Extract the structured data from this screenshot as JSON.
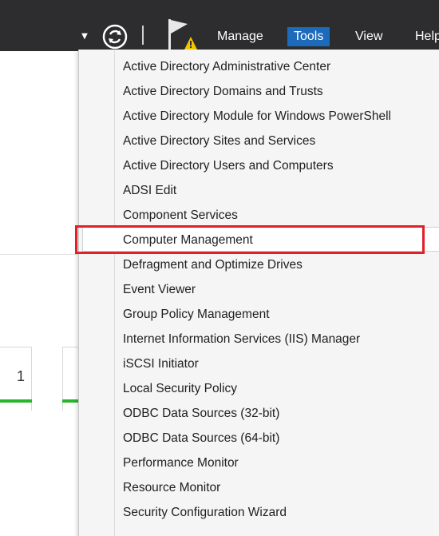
{
  "toolbar": {
    "menus": [
      "Manage",
      "Tools",
      "View",
      "Help"
    ],
    "active_menu": "Tools",
    "accent_color": "#1c6bbb",
    "icons": [
      "dropdown-arrow-icon",
      "refresh-icon",
      "flag-warning-icon"
    ]
  },
  "dashboard": {
    "tile_number": "1",
    "status_color": "#2bb52b"
  },
  "tools_menu": {
    "items": [
      "Active Directory Administrative Center",
      "Active Directory Domains and Trusts",
      "Active Directory Module for Windows PowerShell",
      "Active Directory Sites and Services",
      "Active Directory Users and Computers",
      "ADSI Edit",
      "Component Services",
      "Computer Management",
      "Defragment and Optimize Drives",
      "Event Viewer",
      "Group Policy Management",
      "Internet Information Services (IIS) Manager",
      "iSCSI Initiator",
      "Local Security Policy",
      "ODBC Data Sources (32-bit)",
      "ODBC Data Sources (64-bit)",
      "Performance Monitor",
      "Resource Monitor",
      "Security Configuration Wizard"
    ],
    "highlighted_item": "Computer Management",
    "highlight_color": "#e0202a"
  }
}
